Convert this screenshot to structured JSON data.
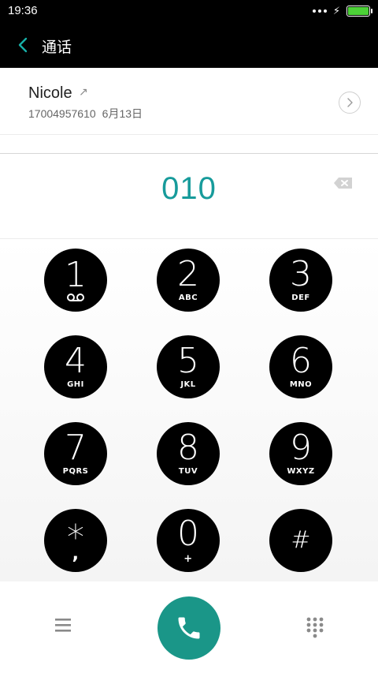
{
  "status_bar": {
    "time": "19:36",
    "battery_level": 1.0,
    "icons": [
      "more-dots-icon",
      "charging-bolt-icon",
      "battery-icon"
    ]
  },
  "header": {
    "title": "通话",
    "back_icon": "chevron-left-icon"
  },
  "recent_call": {
    "name": "Nicole",
    "call_direction_icon": "outgoing-arrow-icon",
    "number": "17004957610",
    "date": "6月13日",
    "detail_icon": "chevron-right-circle-icon"
  },
  "dialed_number": "010",
  "keypad": [
    {
      "digit": "1",
      "letters": ""
    },
    {
      "digit": "2",
      "letters": "ABC"
    },
    {
      "digit": "3",
      "letters": "DEF"
    },
    {
      "digit": "4",
      "letters": "GHI"
    },
    {
      "digit": "5",
      "letters": "JKL"
    },
    {
      "digit": "6",
      "letters": "MNO"
    },
    {
      "digit": "7",
      "letters": "PQRS"
    },
    {
      "digit": "8",
      "letters": "TUV"
    },
    {
      "digit": "9",
      "letters": "WXYZ"
    },
    {
      "digit": "*",
      "letters": ","
    },
    {
      "digit": "0",
      "letters": "+"
    },
    {
      "digit": "#",
      "letters": ""
    }
  ],
  "bottom_bar": {
    "menu_icon": "menu-lines-icon",
    "call_icon": "phone-icon",
    "dialpad_icon": "dialpad-grid-icon"
  },
  "colors": {
    "accent": "#179b9b",
    "call_button": "#1a9688",
    "key_background": "#000000",
    "battery": "#4cd137"
  }
}
